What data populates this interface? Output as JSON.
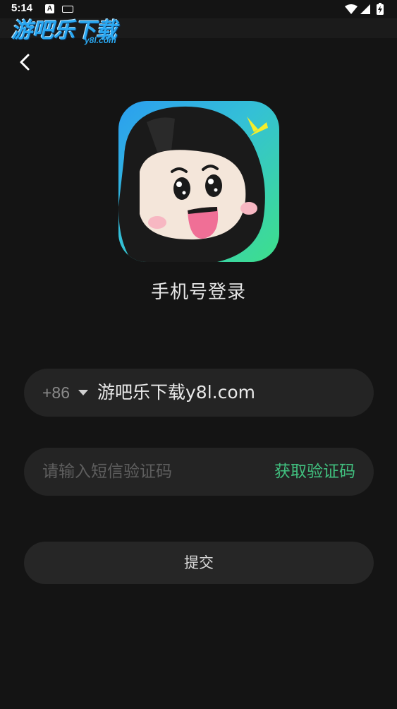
{
  "status_bar": {
    "time": "5:14",
    "a_badge": "A",
    "icons": [
      "wifi-icon",
      "signal-icon",
      "battery-charging-icon"
    ]
  },
  "watermark": {
    "title": "游吧乐下载",
    "subtitle": "y8l.com"
  },
  "header": {
    "back_icon": "chevron-left-icon"
  },
  "app_icon": {
    "accent_colors": [
      "#2b9ef0",
      "#3ee08a"
    ],
    "name": "app-logo-icon"
  },
  "page": {
    "title": "手机号登录"
  },
  "phone": {
    "country_code": "+86",
    "value": "游吧乐下载y8l.com"
  },
  "code": {
    "placeholder": "请输入短信验证码",
    "get_code_label": "获取验证码"
  },
  "submit": {
    "label": "提交"
  },
  "colors": {
    "background": "#141414",
    "field": "#242424",
    "accent": "#41c07f"
  }
}
